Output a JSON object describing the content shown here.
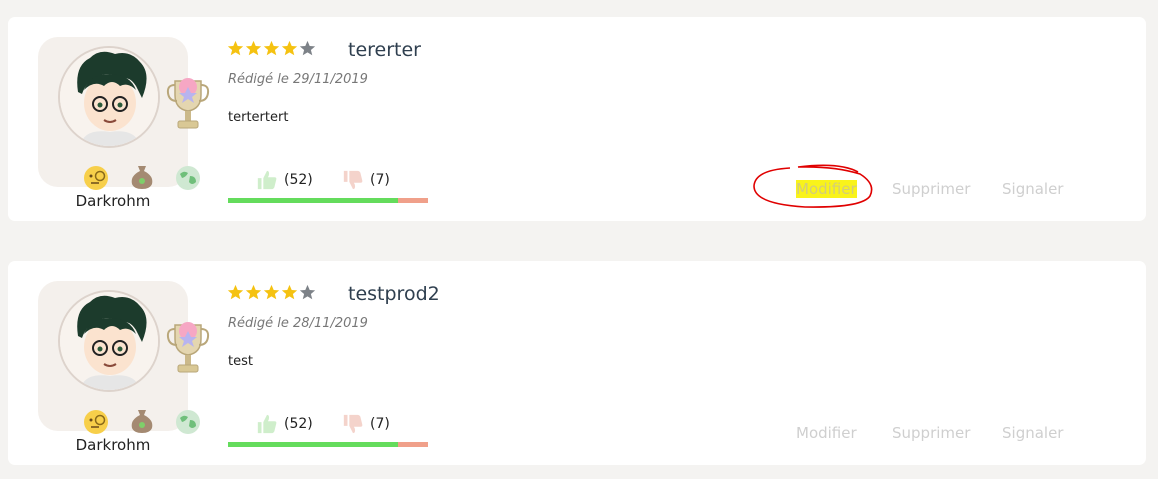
{
  "reviews": [
    {
      "username": "Darkrohm",
      "rating": 4,
      "rating_max": 5,
      "title": "tererter",
      "date": "Rédigé le 29/11/2019",
      "text": "tertertert",
      "likes": "(52)",
      "dislikes": "(7)",
      "like_ratio": 0.85,
      "actions": {
        "modify": "Modifier",
        "delete": "Supprimer",
        "report": "Signaler"
      }
    },
    {
      "username": "Darkrohm",
      "rating": 4,
      "rating_max": 5,
      "title": "testprod2",
      "date": "Rédigé le 28/11/2019",
      "text": "test",
      "likes": "(52)",
      "dislikes": "(7)",
      "like_ratio": 0.85,
      "actions": {
        "modify": "Modifier",
        "delete": "Supprimer",
        "report": "Signaler"
      }
    }
  ],
  "icons": {
    "avatar": "anime-avatar",
    "trophy": "trophy-icon",
    "medals": [
      "monocle-emoji-icon",
      "money-bag-icon",
      "globe-icon"
    ],
    "like": "thumbs-up-icon",
    "dislike": "thumbs-down-icon",
    "star": "star-icon"
  },
  "colors": {
    "star_filled": "#f5c211",
    "star_empty": "#7d8288",
    "bar_positive": "#64dc5c",
    "bar_negative": "#f0a08a",
    "highlight": "#f9f31a",
    "annotation": "#e00000"
  }
}
